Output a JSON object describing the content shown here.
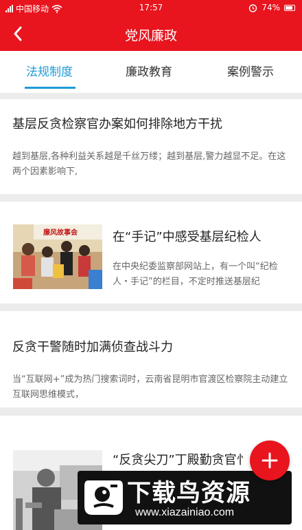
{
  "status_bar": {
    "carrier": "中国移动",
    "time": "17:57",
    "battery": "74%"
  },
  "header": {
    "title": "党风廉政"
  },
  "tabs": [
    {
      "label": "法规制度",
      "active": true
    },
    {
      "label": "廉政教育",
      "active": false
    },
    {
      "label": "案例警示",
      "active": false
    }
  ],
  "articles": [
    {
      "title": "基层反贪检察官办案如何排除地方干扰",
      "summary": "越到基层,各种利益关系越是千丝万缕；越到基层,警力越显不足。在这两个因素影响下,"
    },
    {
      "title": "在“手记”中感受基层纪检人",
      "summary": "在中央纪委监察部网站上，有一个叫“纪检人・手记”的栏目，不定时推送基层纪",
      "image_banner_text": "廉风故事会"
    },
    {
      "title": "反贪干警随时加满侦查战斗力",
      "summary": "当“互联网+”成为热门搜索词时，云南省昆明市官渡区检察院主动建立互联网思维模式，"
    },
    {
      "title": "“反贪尖刀”丁殿勤贪官忄"
    }
  ],
  "watermark": {
    "text": "下载鸟资源",
    "url": "www.xiazainiao.com"
  },
  "colors": {
    "primary": "#e8141e",
    "accent": "#1e9bd7"
  },
  "icons": {
    "back": "back-arrow-icon",
    "fab": "plus-icon"
  }
}
